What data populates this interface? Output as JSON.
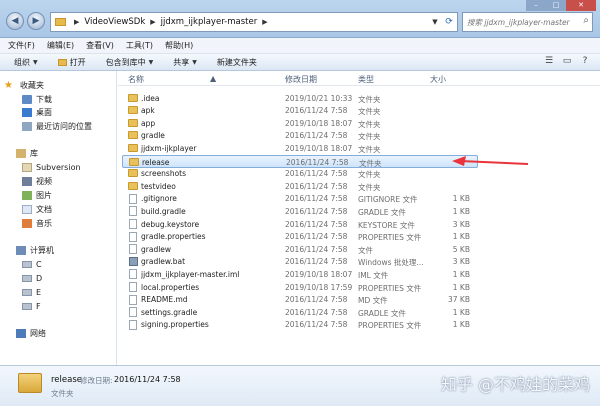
{
  "address_bar": {
    "crumbs": [
      "VideoViewSDk",
      "jjdxm_ijkplayer-master"
    ],
    "search_placeholder": "搜索 jjdxm_ijkplayer-master"
  },
  "menu": [
    "文件(F)",
    "编辑(E)",
    "查看(V)",
    "工具(T)",
    "帮助(H)"
  ],
  "toolbar": {
    "organize": "组织",
    "open": "打开",
    "include_in_library": "包含到库中",
    "share": "共享",
    "new_folder": "新建文件夹"
  },
  "nav": {
    "favorites": "收藏夹",
    "downloads": "下载",
    "desktop": "桌面",
    "recent": "最近访问的位置",
    "libraries": "库",
    "subversion": "Subversion",
    "videos": "视频",
    "pictures": "图片",
    "documents": "文档",
    "music": "音乐",
    "computer": "计算机",
    "drives": [
      "C",
      "D",
      "E",
      "F"
    ],
    "network": "网络"
  },
  "columns": {
    "name": "名称",
    "modified": "修改日期",
    "type": "类型",
    "size": "大小"
  },
  "files": [
    {
      "name": ".idea",
      "date": "2019/10/21 10:33",
      "type": "文件夹",
      "size": "",
      "kind": "folder"
    },
    {
      "name": "apk",
      "date": "2016/11/24 7:58",
      "type": "文件夹",
      "size": "",
      "kind": "folder"
    },
    {
      "name": "app",
      "date": "2019/10/18 18:07",
      "type": "文件夹",
      "size": "",
      "kind": "folder"
    },
    {
      "name": "gradle",
      "date": "2016/11/24 7:58",
      "type": "文件夹",
      "size": "",
      "kind": "folder"
    },
    {
      "name": "jjdxm-ijkplayer",
      "date": "2019/10/18 18:07",
      "type": "文件夹",
      "size": "",
      "kind": "folder"
    },
    {
      "name": "release",
      "date": "2016/11/24 7:58",
      "type": "文件夹",
      "size": "",
      "kind": "folder",
      "selected": true
    },
    {
      "name": "screenshots",
      "date": "2016/11/24 7:58",
      "type": "文件夹",
      "size": "",
      "kind": "folder"
    },
    {
      "name": "testvideo",
      "date": "2016/11/24 7:58",
      "type": "文件夹",
      "size": "",
      "kind": "folder"
    },
    {
      "name": ".gitignore",
      "date": "2016/11/24 7:58",
      "type": "GITIGNORE 文件",
      "size": "1 KB",
      "kind": "file"
    },
    {
      "name": "build.gradle",
      "date": "2016/11/24 7:58",
      "type": "GRADLE 文件",
      "size": "1 KB",
      "kind": "file"
    },
    {
      "name": "debug.keystore",
      "date": "2016/11/24 7:58",
      "type": "KEYSTORE 文件",
      "size": "3 KB",
      "kind": "file"
    },
    {
      "name": "gradle.properties",
      "date": "2016/11/24 7:58",
      "type": "PROPERTIES 文件",
      "size": "1 KB",
      "kind": "file"
    },
    {
      "name": "gradlew",
      "date": "2016/11/24 7:58",
      "type": "文件",
      "size": "5 KB",
      "kind": "file"
    },
    {
      "name": "gradlew.bat",
      "date": "2016/11/24 7:58",
      "type": "Windows 批处理...",
      "size": "3 KB",
      "kind": "bat"
    },
    {
      "name": "jjdxm_ijkplayer-master.iml",
      "date": "2019/10/18 18:07",
      "type": "IML 文件",
      "size": "1 KB",
      "kind": "file"
    },
    {
      "name": "local.properties",
      "date": "2019/10/18 17:59",
      "type": "PROPERTIES 文件",
      "size": "1 KB",
      "kind": "file"
    },
    {
      "name": "README.md",
      "date": "2016/11/24 7:58",
      "type": "MD 文件",
      "size": "37 KB",
      "kind": "file"
    },
    {
      "name": "settings.gradle",
      "date": "2016/11/24 7:58",
      "type": "GRADLE 文件",
      "size": "1 KB",
      "kind": "file"
    },
    {
      "name": "signing.properties",
      "date": "2016/11/24 7:58",
      "type": "PROPERTIES 文件",
      "size": "1 KB",
      "kind": "file"
    }
  ],
  "details": {
    "name": "release",
    "modified_label": "修改日期:",
    "modified_value": "2016/11/24 7:58",
    "type": "文件夹"
  },
  "watermark": "知乎 @不鸡娃的菜鸡",
  "colors": {
    "selection": "#cde4fb",
    "annotation_arrow": "#e8343a",
    "folder": "#e9c15a"
  }
}
